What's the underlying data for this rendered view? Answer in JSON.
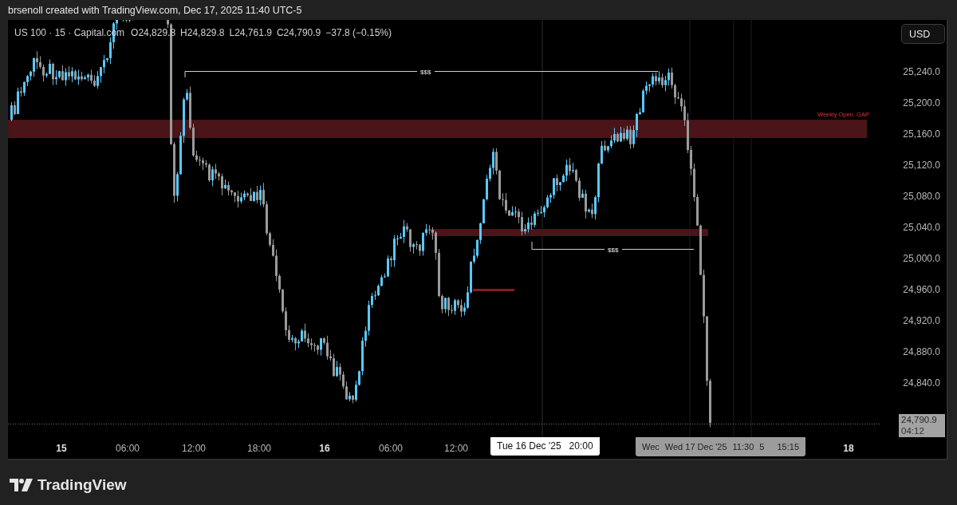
{
  "header": {
    "caption": "brsenoll created with TradingView.com, Dec 17, 2025 11:40 UTC-5"
  },
  "legend": {
    "symbol": "US 100 · 15 · Capital.com",
    "open": "O24,829.8",
    "high": "H24,829.8",
    "low": "L24,761.9",
    "close": "C24,790.9",
    "change": "−37.8 (−0.15%)"
  },
  "currency_button": "USD",
  "annotations": [
    {
      "kind": "zone-label",
      "text": "Weekly Open. GAP"
    },
    {
      "kind": "liquidity-line",
      "text": "$$$"
    },
    {
      "kind": "liquidity-line",
      "text": "$$$"
    }
  ],
  "price_axis": {
    "labels": [
      "25,240.0",
      "25,200.0",
      "25,160.0",
      "25,120.0",
      "25,080.0",
      "25,040.0",
      "25,000.0",
      "24,960.0",
      "24,920.0",
      "24,880.0",
      "24,840.0"
    ],
    "last_price": "24,790.9",
    "countdown": "04:12"
  },
  "time_axis": {
    "labels": [
      {
        "text": "15",
        "major": true
      },
      {
        "text": "06:00",
        "major": false
      },
      {
        "text": "12:00",
        "major": false
      },
      {
        "text": "18:00",
        "major": false
      },
      {
        "text": "16",
        "major": true
      },
      {
        "text": "06:00",
        "major": false
      },
      {
        "text": "12:00",
        "major": false
      },
      {
        "text": "18",
        "major": true
      }
    ],
    "crosshair_label": "Tue 16 Dec '25   20:00",
    "range_labels": [
      "Wec",
      "Wed 17 Dec '25",
      "11:30",
      "5",
      "15:15"
    ]
  },
  "logo": "TradingView"
}
